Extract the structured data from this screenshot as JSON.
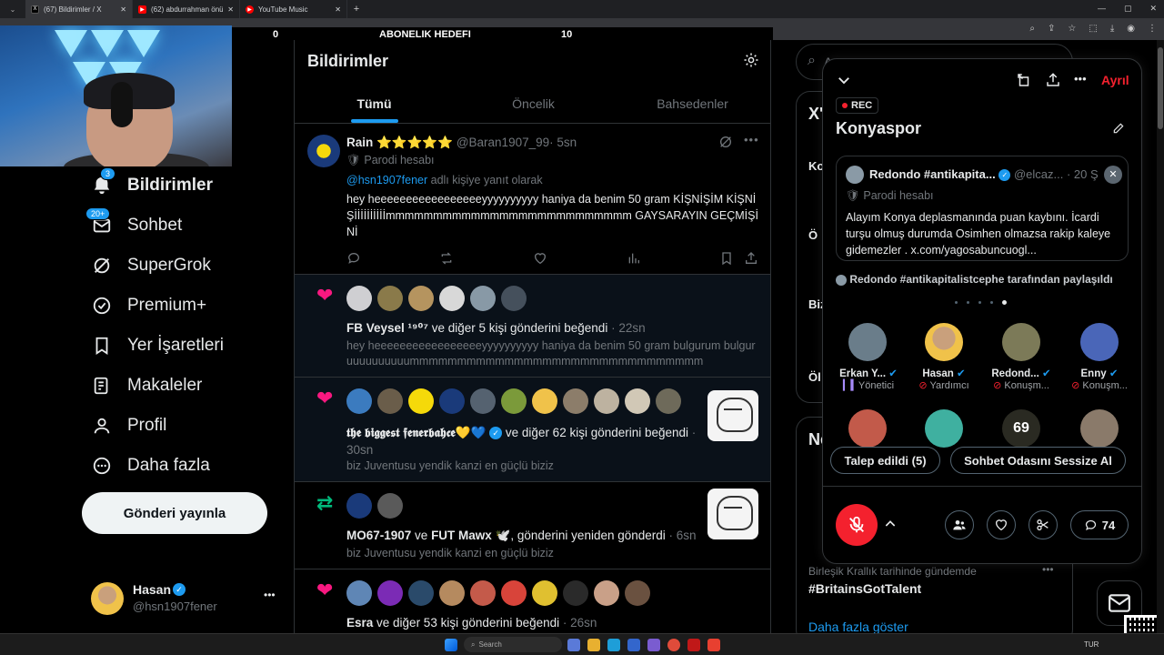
{
  "browser": {
    "tabs": [
      {
        "title": "(67) Bildirimler / X",
        "fav": "X",
        "fav_color": "#000000"
      },
      {
        "title": "(62) abdurrahman önül mevlam",
        "fav": "▶",
        "fav_color": "#ff0000"
      },
      {
        "title": "YouTube Music",
        "fav": "▶",
        "fav_color": "#ff0000"
      }
    ],
    "new_tab": "+"
  },
  "stream_goal": {
    "left": "0",
    "title": "ABONELIK HEDEFI",
    "right": "10"
  },
  "sidebar": {
    "items": [
      {
        "label": "Bildirimler",
        "icon": "bell-icon",
        "badge": "3",
        "bold": true
      },
      {
        "label": "Sohbet",
        "icon": "mail-icon",
        "badge": "20+"
      },
      {
        "label": "SuperGrok",
        "icon": "grok-icon"
      },
      {
        "label": "Premium+",
        "icon": "verified-icon"
      },
      {
        "label": "Yer İşaretleri",
        "icon": "bookmark-icon"
      },
      {
        "label": "Makaleler",
        "icon": "article-icon"
      },
      {
        "label": "Profil",
        "icon": "person-icon"
      },
      {
        "label": "Daha fazla",
        "icon": "more-circle-icon"
      }
    ],
    "post_button": "Gönderi yayınla",
    "account": {
      "name": "Hasan",
      "handle": "@hsn1907fener",
      "more": "•••"
    }
  },
  "notifications": {
    "title": "Bildirimler",
    "tabs": [
      "Tümü",
      "Öncelik",
      "Bahsedenler"
    ],
    "reply": {
      "name": "Rain ⭐⭐⭐⭐⭐",
      "handle": "@Baran1907_99",
      "time": "· 5sn",
      "parody": "Parodi hesabı",
      "replying_to": "@hsn1907fener",
      "replying_suffix": " adlı kişiye yanıt olarak",
      "text": "hey heeeeeeeeeeeeeeeeeyyyyyyyyyy haniya da benim 50 gram KİŞNİŞİM KİŞNİŞİİİİİİİİİİmmmmmmmmmmmmmmmmmmmmmmmmmm GAYSARAYIN GEÇMİŞİNİ"
    },
    "items": [
      {
        "type": "like",
        "actor": "FB Veysel ¹⁹⁰⁷",
        "action": " ve diğer 5 kişi gönderini beğendi",
        "time": " · 22sn",
        "preview": "hey heeeeeeeeeeeeeeeeeyyyyyyyyyy haniya da benim 50 gram bulgurum bulguruuuuuuuuuummmmmmmmmmmmmmmmmmmmmmmmmmmmmmm"
      },
      {
        "type": "like",
        "actor": "𝖙𝖍𝖊 𝖇𝖎𝖌𝖌𝖊𝖘𝖙 𝖋𝖊𝖓𝖊𝖗𝖇𝖆𝖍𝖈𝖊💛💙",
        "action": " ve diğer 62 kişi gönderini beğendi",
        "time": " · 30sn",
        "preview": "biz Juventusu yendik kanzi en güçlü biziz"
      },
      {
        "type": "repost",
        "actor": "MO67-1907",
        "action_mid": " ve ",
        "actor2": "FUT Mawx 🕊️",
        "action": ", gönderini yeniden gönderdi",
        "time": " · 6sn",
        "preview": "biz Juventusu yendik kanzi en güçlü biziz"
      },
      {
        "type": "like",
        "actor": "Esra",
        "action": " ve diğer 53 kişi gönderini beğendi",
        "time": " · 26sn"
      }
    ]
  },
  "right_column": {
    "search_placeholder": "A",
    "trend_partial_1": "Ö",
    "section_partial": "Ne",
    "trend_location": "Birleşik Krallık tarihinde gündemde",
    "trend_name": "#BritainsGotTalent",
    "show_more": "Daha fazla göster"
  },
  "space": {
    "leave": "Ayrıl",
    "rec": "REC",
    "title": "Konyaspor",
    "pinned": {
      "name": "Redondo #antikapita...",
      "handle": "@elcaz...",
      "time": "· 20 Ş",
      "parody": "Parodi hesabı",
      "text": "Alayım Konya deplasmanında puan kaybını. İcardi turşu olmuş durumda Osimhen olmazsa rakip kaleye gidemezler . x.com/yagosabuncuogl..."
    },
    "shared_by": "Redondo #antikapitalistcephe tarafından paylaşıldı",
    "participants": [
      {
        "name": "Erkan Y...",
        "role": "Yönetici",
        "role_icon": "sound-wave-icon",
        "role_color": "#a78bfa"
      },
      {
        "name": "Hasan",
        "role": "Yardımcı",
        "role_icon": "mic-off-icon",
        "role_color": "#f4212e"
      },
      {
        "name": "Redond...",
        "role": "Konuşm...",
        "role_icon": "mic-off-icon",
        "role_color": "#f4212e"
      },
      {
        "name": "Enny",
        "role": "Konuşm...",
        "role_icon": "mic-off-icon",
        "role_color": "#f4212e"
      }
    ],
    "requests_button": "Talep edildi (5)",
    "mute_button": "Sohbet Odasını Sessize Al",
    "comment_count": "74"
  },
  "taskbar": {
    "search": "Search",
    "lang": "TUR"
  },
  "colors": {
    "accent": "#1d9bf0",
    "like": "#f91880",
    "repost": "#00ba7c",
    "mic_red": "#f4212e"
  }
}
